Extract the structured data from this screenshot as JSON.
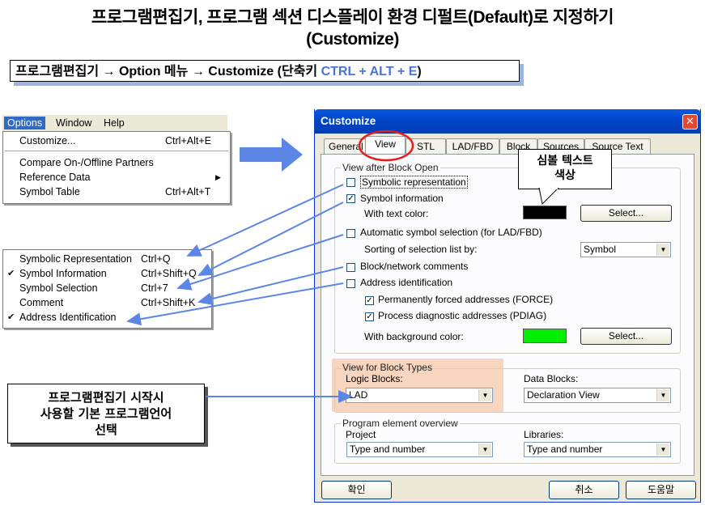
{
  "slide": {
    "title_line1": "프로그램편집기, 프로그램 섹션 디스플레이 환경 디펄트(Default)로 지정하기",
    "title_line2": "(Customize)",
    "path_prefix": "프로그램편집기 → ",
    "path_option": "Option",
    "path_menu": " 메뉴 → ",
    "path_customize": "Customize",
    "path_shortcut_label": " (단축키 ",
    "path_shortcut_keys": "CTRL + ALT + E",
    "path_close": ")"
  },
  "menubar": {
    "items": [
      "Options",
      "Window",
      "Help"
    ]
  },
  "options_menu": {
    "items": [
      {
        "label": "Customize...",
        "shortcut": "Ctrl+Alt+E"
      },
      {
        "label": "Compare On-/Offline Partners",
        "shortcut": ""
      },
      {
        "label": "Reference Data",
        "shortcut": ""
      },
      {
        "label": "Symbol Table",
        "shortcut": "Ctrl+Alt+T"
      }
    ]
  },
  "view_menu": {
    "items": [
      {
        "label": "Symbolic Representation",
        "shortcut": "Ctrl+Q",
        "checked": false
      },
      {
        "label": "Symbol Information",
        "shortcut": "Ctrl+Shift+Q",
        "checked": true
      },
      {
        "label": "Symbol Selection",
        "shortcut": "Ctrl+7",
        "checked": false
      },
      {
        "label": "Comment",
        "shortcut": "Ctrl+Shift+K",
        "checked": false
      },
      {
        "label": "Address Identification",
        "shortcut": "",
        "checked": true
      }
    ]
  },
  "dialog": {
    "title": "Customize",
    "close_glyph": "✕",
    "tabs": [
      "General",
      "View",
      "STL",
      "LAD/FBD",
      "Block",
      "Sources",
      "Source Text"
    ],
    "active_tab": "View",
    "view_after_block_open": {
      "legend": "View after Block Open",
      "symbolic_representation": "Symbolic representation",
      "symbol_information": "Symbol information",
      "with_text_color": "With text color:",
      "text_color": "#000000",
      "select_button": "Select...",
      "automatic_symbol_selection": "Automatic symbol selection (for LAD/FBD)",
      "sorting_label": "Sorting of selection list by:",
      "sorting_value": "Symbol",
      "block_network_comments": "Block/network comments",
      "address_identification": "Address identification",
      "permanently_forced": "Permanently forced addresses (FORCE)",
      "process_diagnostic": "Process diagnostic addresses (PDIAG)",
      "with_background_color": "With background color:",
      "background_color": "#00ee00",
      "select_button_2": "Select..."
    },
    "view_for_block_types": {
      "legend": "View for Block Types",
      "logic_blocks_label": "Logic Blocks:",
      "logic_blocks_value": "LAD",
      "data_blocks_label": "Data Blocks:",
      "data_blocks_value": "Declaration View"
    },
    "program_element_overview": {
      "legend": "Program element overview",
      "project_label": "Project",
      "project_value": "Type and number",
      "libraries_label": "Libraries:",
      "libraries_value": "Type and number"
    },
    "buttons": {
      "ok": "확인",
      "cancel": "취소",
      "help": "도움말"
    }
  },
  "annotations": {
    "callout": "심볼 텍스트\n색상",
    "callout_line1": "심볼 텍스트",
    "callout_line2": "색상",
    "note_line1": "프로그램편집기 시작시",
    "note_line2": "사용할 기본 프로그램언어",
    "note_line3": "선택"
  },
  "colors": {
    "arrow": "#5b86e5",
    "highlight": "#f5a670",
    "titlebar": "#0047c9",
    "hotkey": "#4a73d8",
    "circle": "#e02020"
  }
}
